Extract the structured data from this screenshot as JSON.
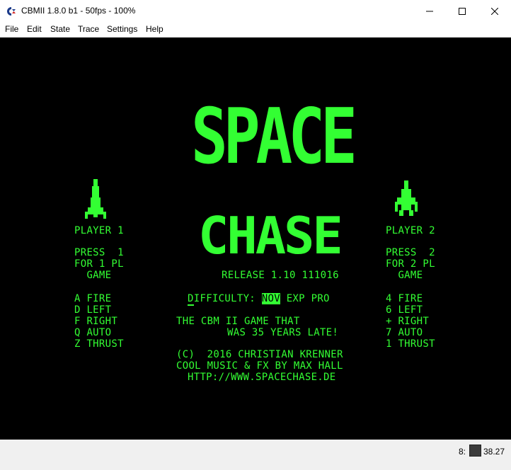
{
  "window": {
    "title": "CBMII 1.8.0 b1 - 50fps - 100%"
  },
  "menu": [
    "File",
    "Edit",
    "State",
    "Trace",
    "Settings",
    "Help"
  ],
  "game": {
    "logo_line1": "SPACE",
    "logo_line2": "CHASE",
    "release": "RELEASE 1.10 111016",
    "player1": {
      "title": "PLAYER 1",
      "press": [
        "PRESS  1",
        "FOR 1 PL",
        "  GAME"
      ],
      "keys": [
        "A FIRE",
        "D LEFT",
        "F RIGHT",
        "Q AUTO",
        "Z THRUST"
      ]
    },
    "player2": {
      "title": "PLAYER 2",
      "press": [
        "PRESS  2",
        "FOR 2 PL",
        "  GAME"
      ],
      "keys": [
        "4 FIRE",
        "6 LEFT",
        "+ RIGHT",
        "7 AUTO",
        "1 THRUST"
      ]
    },
    "difficulty": {
      "label_first": "D",
      "label_rest": "IFFICULTY:",
      "selected": "NOV",
      "others": "EXP PRO"
    },
    "tagline": [
      "THE CBM II GAME THAT",
      "WAS 35 YEARS LATE!"
    ],
    "credits": [
      "(C)  2016 CHRISTIAN KRENNER",
      "COOL MUSIC & FX BY MAX HALL",
      "HTTP://WWW.SPACECHASE.DE"
    ]
  },
  "status": {
    "drive_label": "8:",
    "value": "38.27"
  },
  "colors": {
    "screen_fg": "#33ff33",
    "screen_bg": "#000000"
  }
}
